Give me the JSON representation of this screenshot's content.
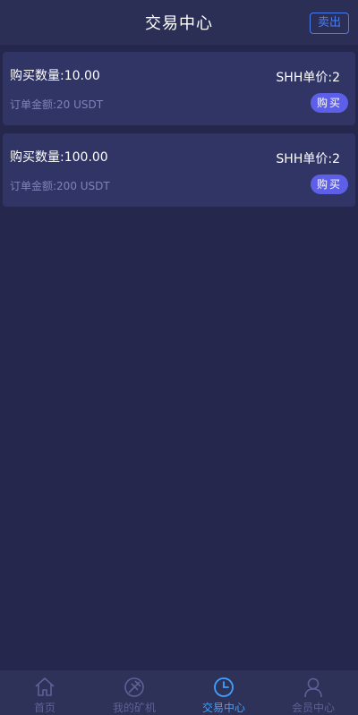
{
  "header": {
    "title": "交易中心",
    "sell_label": "卖出"
  },
  "orders": [
    {
      "qty_label": "购买数量:",
      "qty": "10.00",
      "price_label": "SHH单价:",
      "price": "2",
      "amount_label": "订单金额:",
      "amount": "20 USDT",
      "buy_label": "购买"
    },
    {
      "qty_label": "购买数量:",
      "qty": "100.00",
      "price_label": "SHH单价:",
      "price": "2",
      "amount_label": "订单金额:",
      "amount": "200 USDT",
      "buy_label": "购买"
    }
  ],
  "tabbar": {
    "items": [
      {
        "label": "首页",
        "icon": "home-icon",
        "active": false
      },
      {
        "label": "我的矿机",
        "icon": "miner-icon",
        "active": false
      },
      {
        "label": "交易中心",
        "icon": "clock-icon",
        "active": true
      },
      {
        "label": "会员中心",
        "icon": "user-icon",
        "active": false
      }
    ]
  },
  "colors": {
    "background": "#25284c",
    "accent": "#3ea2ff",
    "buy_button": "#5e5fe8",
    "sell_border": "#4a7cf2"
  }
}
